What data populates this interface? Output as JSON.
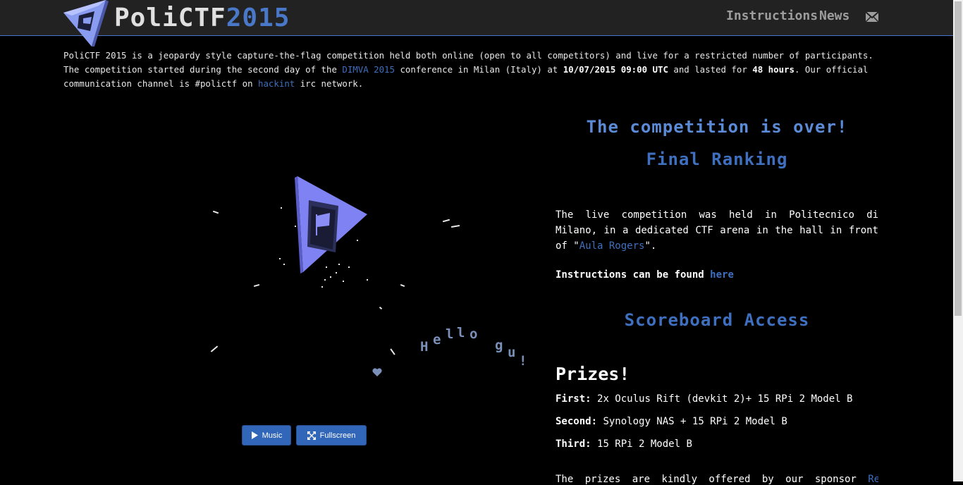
{
  "brand": {
    "name_part1": "PoliCTF",
    "name_part2": "2015"
  },
  "nav": {
    "instructions": "Instructions",
    "news": "News",
    "mail_icon": "envelope-icon"
  },
  "intro": {
    "p1": "PoliCTF 2015 is a jeopardy style capture-the-flag competition held both online (open to all competitors) and live for a restricted number of participants. The competition started during the second day of the ",
    "dimva_link": "DIMVA 2015",
    "p2": " conference in Milan (Italy) at ",
    "start_time": "10/07/2015 09:00 UTC",
    "p3": " and lasted for ",
    "duration": "48 hours",
    "p4": ". Our official communication channel is #polictf on ",
    "hackint_link": "hackint",
    "p5": " irc network."
  },
  "demo": {
    "hello_text": "Hello gu!",
    "music_button": "Music",
    "fullscreen_button": "Fullscreen"
  },
  "main": {
    "competition_over": "The competition is over!",
    "final_ranking": "Final Ranking",
    "live_p1": "The live competition was held in Politecnico di Milano, in a dedicated CTF arena in the hall in front of \"",
    "aula_link": "Aula Rogers",
    "live_p2": "\".",
    "instructions_text": "Instructions can be found ",
    "here_link": "here",
    "scoreboard_access": "Scoreboard Access",
    "prizes_title": "Prizes!",
    "prizes": [
      {
        "label": "First:",
        "value": "2x Oculus Rift (devkit 2)+ 15 RPi 2 Model B"
      },
      {
        "label": "Second:",
        "value": "Synology NAS + 15 RPi 2 Model B"
      },
      {
        "label": "Third:",
        "value": "15 RPi 2 Model B"
      }
    ],
    "sponsor_text": "The prizes are kindly offered by our sponsor ",
    "sponsor_link": "Reply"
  },
  "colors": {
    "accent": "#3f6fbf",
    "navbar": "#222222",
    "background": "#000000",
    "logo": "#8a9cf0"
  }
}
